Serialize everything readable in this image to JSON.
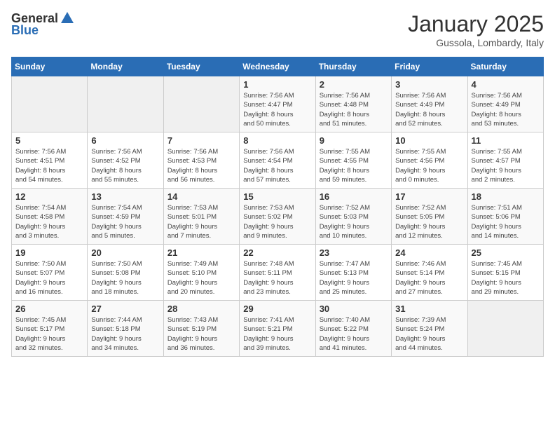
{
  "header": {
    "logo_general": "General",
    "logo_blue": "Blue",
    "month_year": "January 2025",
    "location": "Gussola, Lombardy, Italy"
  },
  "weekdays": [
    "Sunday",
    "Monday",
    "Tuesday",
    "Wednesday",
    "Thursday",
    "Friday",
    "Saturday"
  ],
  "weeks": [
    [
      {
        "day": "",
        "info": ""
      },
      {
        "day": "",
        "info": ""
      },
      {
        "day": "",
        "info": ""
      },
      {
        "day": "1",
        "info": "Sunrise: 7:56 AM\nSunset: 4:47 PM\nDaylight: 8 hours\nand 50 minutes."
      },
      {
        "day": "2",
        "info": "Sunrise: 7:56 AM\nSunset: 4:48 PM\nDaylight: 8 hours\nand 51 minutes."
      },
      {
        "day": "3",
        "info": "Sunrise: 7:56 AM\nSunset: 4:49 PM\nDaylight: 8 hours\nand 52 minutes."
      },
      {
        "day": "4",
        "info": "Sunrise: 7:56 AM\nSunset: 4:49 PM\nDaylight: 8 hours\nand 53 minutes."
      }
    ],
    [
      {
        "day": "5",
        "info": "Sunrise: 7:56 AM\nSunset: 4:51 PM\nDaylight: 8 hours\nand 54 minutes."
      },
      {
        "day": "6",
        "info": "Sunrise: 7:56 AM\nSunset: 4:52 PM\nDaylight: 8 hours\nand 55 minutes."
      },
      {
        "day": "7",
        "info": "Sunrise: 7:56 AM\nSunset: 4:53 PM\nDaylight: 8 hours\nand 56 minutes."
      },
      {
        "day": "8",
        "info": "Sunrise: 7:56 AM\nSunset: 4:54 PM\nDaylight: 8 hours\nand 57 minutes."
      },
      {
        "day": "9",
        "info": "Sunrise: 7:55 AM\nSunset: 4:55 PM\nDaylight: 8 hours\nand 59 minutes."
      },
      {
        "day": "10",
        "info": "Sunrise: 7:55 AM\nSunset: 4:56 PM\nDaylight: 9 hours\nand 0 minutes."
      },
      {
        "day": "11",
        "info": "Sunrise: 7:55 AM\nSunset: 4:57 PM\nDaylight: 9 hours\nand 2 minutes."
      }
    ],
    [
      {
        "day": "12",
        "info": "Sunrise: 7:54 AM\nSunset: 4:58 PM\nDaylight: 9 hours\nand 3 minutes."
      },
      {
        "day": "13",
        "info": "Sunrise: 7:54 AM\nSunset: 4:59 PM\nDaylight: 9 hours\nand 5 minutes."
      },
      {
        "day": "14",
        "info": "Sunrise: 7:53 AM\nSunset: 5:01 PM\nDaylight: 9 hours\nand 7 minutes."
      },
      {
        "day": "15",
        "info": "Sunrise: 7:53 AM\nSunset: 5:02 PM\nDaylight: 9 hours\nand 9 minutes."
      },
      {
        "day": "16",
        "info": "Sunrise: 7:52 AM\nSunset: 5:03 PM\nDaylight: 9 hours\nand 10 minutes."
      },
      {
        "day": "17",
        "info": "Sunrise: 7:52 AM\nSunset: 5:05 PM\nDaylight: 9 hours\nand 12 minutes."
      },
      {
        "day": "18",
        "info": "Sunrise: 7:51 AM\nSunset: 5:06 PM\nDaylight: 9 hours\nand 14 minutes."
      }
    ],
    [
      {
        "day": "19",
        "info": "Sunrise: 7:50 AM\nSunset: 5:07 PM\nDaylight: 9 hours\nand 16 minutes."
      },
      {
        "day": "20",
        "info": "Sunrise: 7:50 AM\nSunset: 5:08 PM\nDaylight: 9 hours\nand 18 minutes."
      },
      {
        "day": "21",
        "info": "Sunrise: 7:49 AM\nSunset: 5:10 PM\nDaylight: 9 hours\nand 20 minutes."
      },
      {
        "day": "22",
        "info": "Sunrise: 7:48 AM\nSunset: 5:11 PM\nDaylight: 9 hours\nand 23 minutes."
      },
      {
        "day": "23",
        "info": "Sunrise: 7:47 AM\nSunset: 5:13 PM\nDaylight: 9 hours\nand 25 minutes."
      },
      {
        "day": "24",
        "info": "Sunrise: 7:46 AM\nSunset: 5:14 PM\nDaylight: 9 hours\nand 27 minutes."
      },
      {
        "day": "25",
        "info": "Sunrise: 7:45 AM\nSunset: 5:15 PM\nDaylight: 9 hours\nand 29 minutes."
      }
    ],
    [
      {
        "day": "26",
        "info": "Sunrise: 7:45 AM\nSunset: 5:17 PM\nDaylight: 9 hours\nand 32 minutes."
      },
      {
        "day": "27",
        "info": "Sunrise: 7:44 AM\nSunset: 5:18 PM\nDaylight: 9 hours\nand 34 minutes."
      },
      {
        "day": "28",
        "info": "Sunrise: 7:43 AM\nSunset: 5:19 PM\nDaylight: 9 hours\nand 36 minutes."
      },
      {
        "day": "29",
        "info": "Sunrise: 7:41 AM\nSunset: 5:21 PM\nDaylight: 9 hours\nand 39 minutes."
      },
      {
        "day": "30",
        "info": "Sunrise: 7:40 AM\nSunset: 5:22 PM\nDaylight: 9 hours\nand 41 minutes."
      },
      {
        "day": "31",
        "info": "Sunrise: 7:39 AM\nSunset: 5:24 PM\nDaylight: 9 hours\nand 44 minutes."
      },
      {
        "day": "",
        "info": ""
      }
    ]
  ]
}
